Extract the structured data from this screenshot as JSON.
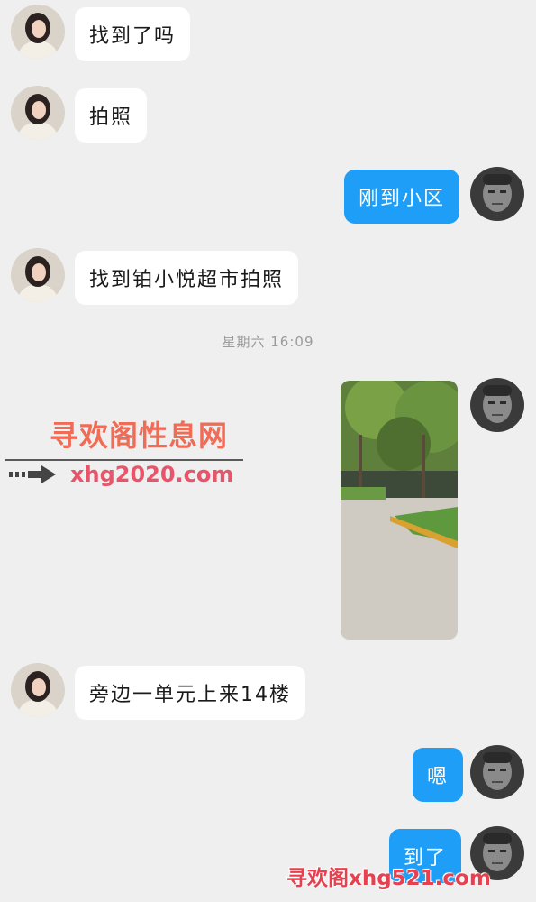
{
  "messages": [
    {
      "side": "in",
      "text": "找到了吗"
    },
    {
      "side": "in",
      "text": "拍照"
    },
    {
      "side": "out",
      "text": "刚到小区"
    },
    {
      "side": "in",
      "text": "找到铂小悦超市拍照"
    },
    {
      "side": "out",
      "text": "[photo]"
    },
    {
      "side": "in",
      "text": "旁边一单元上来14楼"
    },
    {
      "side": "out",
      "text": "嗯"
    },
    {
      "side": "out",
      "text": "到了"
    }
  ],
  "timestamp": "星期六 16:09",
  "watermark": {
    "title": "寻欢阁性息网",
    "site": "xhg2020.com",
    "bottom": "寻欢阁xhg521.com"
  },
  "colors": {
    "background": "#efefef",
    "incoming_bubble": "#ffffff",
    "outgoing_bubble": "#1e9ef7"
  },
  "icons": [
    "female-avatar-icon",
    "male-avatar-icon",
    "arrow-right-icon"
  ]
}
